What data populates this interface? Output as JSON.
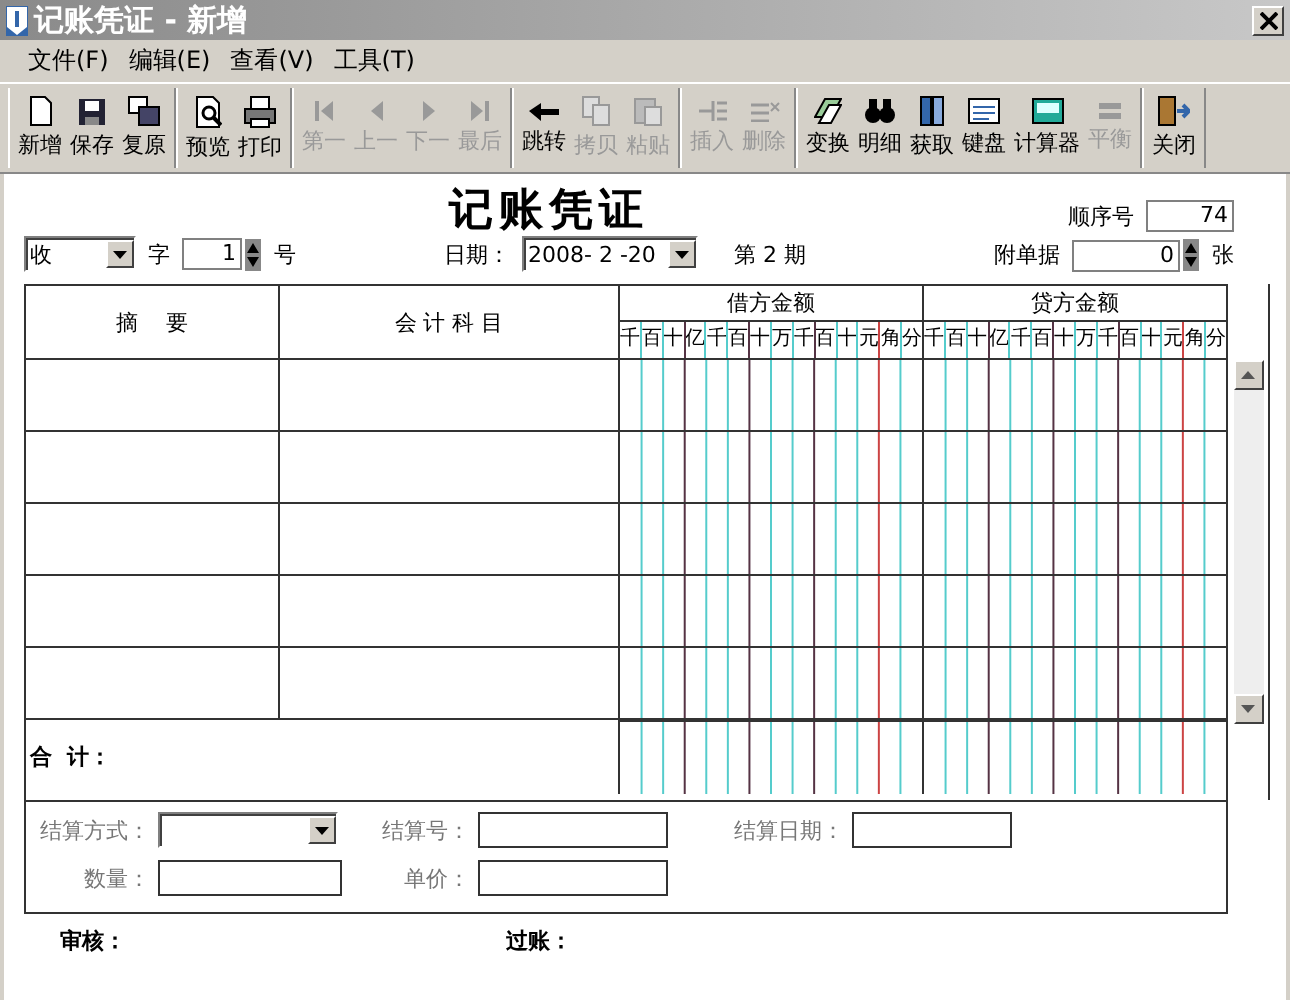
{
  "window": {
    "title": "记账凭证 - 新增"
  },
  "menu": [
    "文件(F)",
    "编辑(E)",
    "查看(V)",
    "工具(T)"
  ],
  "toolbar": [
    [
      {
        "label": "新增",
        "kind": "new",
        "disabled": false
      },
      {
        "label": "保存",
        "kind": "save",
        "disabled": false
      },
      {
        "label": "复原",
        "kind": "restore",
        "disabled": false
      }
    ],
    [
      {
        "label": "预览",
        "kind": "preview",
        "disabled": false
      },
      {
        "label": "打印",
        "kind": "print",
        "disabled": false
      }
    ],
    [
      {
        "label": "第一",
        "kind": "first",
        "disabled": true
      },
      {
        "label": "上一",
        "kind": "prev",
        "disabled": true
      },
      {
        "label": "下一",
        "kind": "next",
        "disabled": true
      },
      {
        "label": "最后",
        "kind": "last",
        "disabled": true
      }
    ],
    [
      {
        "label": "跳转",
        "kind": "jump",
        "disabled": false
      },
      {
        "label": "拷贝",
        "kind": "copy",
        "disabled": true
      },
      {
        "label": "粘贴",
        "kind": "paste",
        "disabled": true
      }
    ],
    [
      {
        "label": "插入",
        "kind": "insert",
        "disabled": true
      },
      {
        "label": "删除",
        "kind": "delete",
        "disabled": true
      }
    ],
    [
      {
        "label": "变换",
        "kind": "switch",
        "disabled": false
      },
      {
        "label": "明细",
        "kind": "detail",
        "disabled": false
      },
      {
        "label": "获取",
        "kind": "fetch",
        "disabled": false
      },
      {
        "label": "键盘",
        "kind": "keyboard",
        "disabled": false
      },
      {
        "label": "计算器",
        "kind": "calculator",
        "disabled": false
      },
      {
        "label": "平衡",
        "kind": "balance",
        "disabled": true
      }
    ],
    [
      {
        "label": "关闭",
        "kind": "close",
        "disabled": false
      }
    ]
  ],
  "voucher": {
    "title": "记账凭证",
    "sequence_label": "顺序号",
    "sequence": "74",
    "type": "收",
    "type_suffix": "字",
    "number": "1",
    "number_suffix": "号",
    "date_label": "日期：",
    "date": "2008- 2 -20",
    "period": "第 2 期",
    "attachments_label": "附单据",
    "attachments": "0",
    "attachments_suffix": "张"
  },
  "table": {
    "columns": [
      "摘    要",
      "会 计 科 目",
      "借方金额",
      "贷方金额"
    ],
    "debit_digits": [
      "千",
      "百",
      "十",
      "亿",
      "千",
      "百",
      "十",
      "万",
      "千",
      "百",
      "十",
      "元",
      "角",
      "分"
    ],
    "credit_digits": [
      "千",
      "百",
      "十",
      "亿",
      "千",
      "百",
      "十",
      "万",
      "千",
      "百",
      "十",
      "元",
      "角",
      "分"
    ],
    "total_label": "合  计："
  },
  "settlement": {
    "method_label": "结算方式：",
    "number_label": "结算号：",
    "date_label": "结算日期：",
    "quantity_label": "数量：",
    "price_label": "单价："
  },
  "footer": {
    "review_label": "审核：",
    "posting_label": "过账："
  }
}
